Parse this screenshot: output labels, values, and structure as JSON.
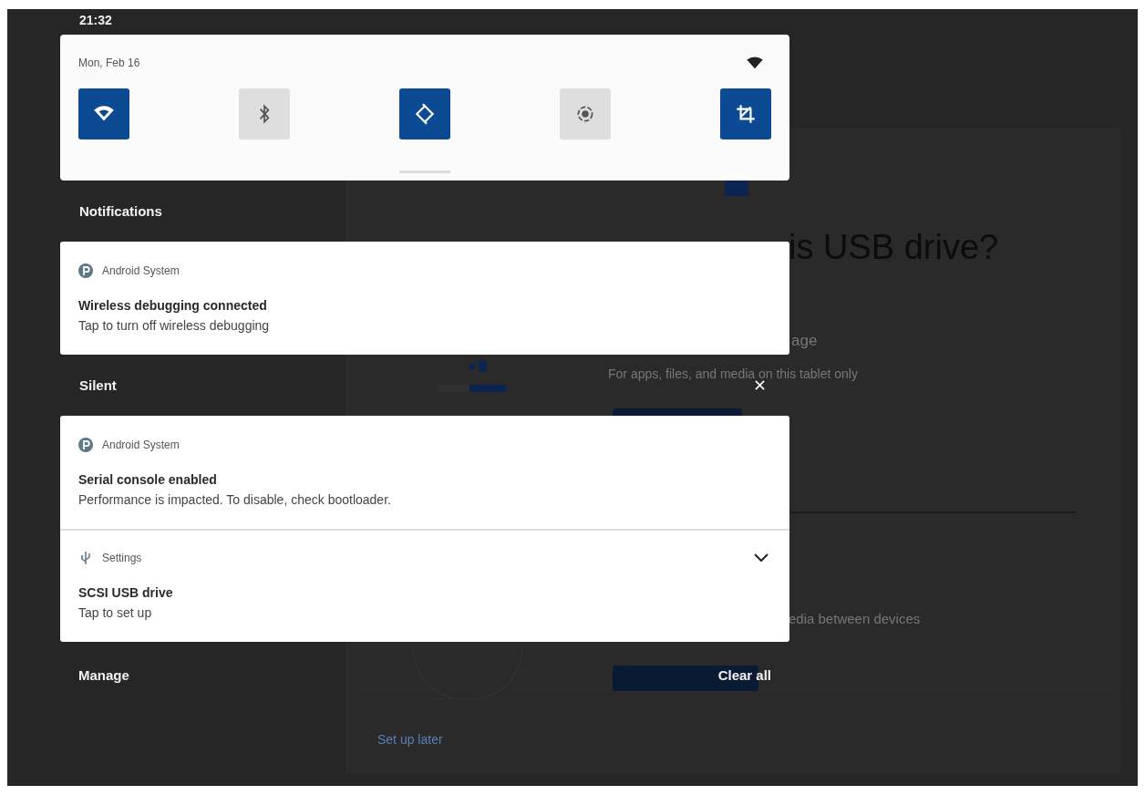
{
  "status_bar": {
    "time": "21:32"
  },
  "quick_settings": {
    "date": "Mon, Feb 16",
    "tiles": [
      {
        "kind": "wifi",
        "on": true
      },
      {
        "kind": "bluetooth",
        "on": false
      },
      {
        "kind": "rotate",
        "on": true
      },
      {
        "kind": "record",
        "on": false
      },
      {
        "kind": "crop",
        "on": true
      }
    ]
  },
  "notifications": {
    "header": "Notifications",
    "items": [
      {
        "app": "Android System",
        "kind": "system",
        "title": "Wireless debugging connected",
        "text": "Tap to turn off wireless debugging"
      }
    ]
  },
  "silent": {
    "header": "Silent",
    "items": [
      {
        "app": "Android System",
        "kind": "system",
        "title": "Serial console enabled",
        "text": "Performance is impacted. To disable, check bootloader."
      },
      {
        "app": "Settings",
        "kind": "usb",
        "title": "SCSI USB drive",
        "text": "Tap to set up",
        "expanded": false
      }
    ]
  },
  "footer": {
    "manage": "Manage",
    "clear_all": "Clear all"
  },
  "background_screen": {
    "heading": "is USB drive?",
    "option_1_title": "age",
    "option_1_text": "For apps, files, and media on this tablet only",
    "option_2_text": "edia between devices",
    "link": "Set up later"
  }
}
